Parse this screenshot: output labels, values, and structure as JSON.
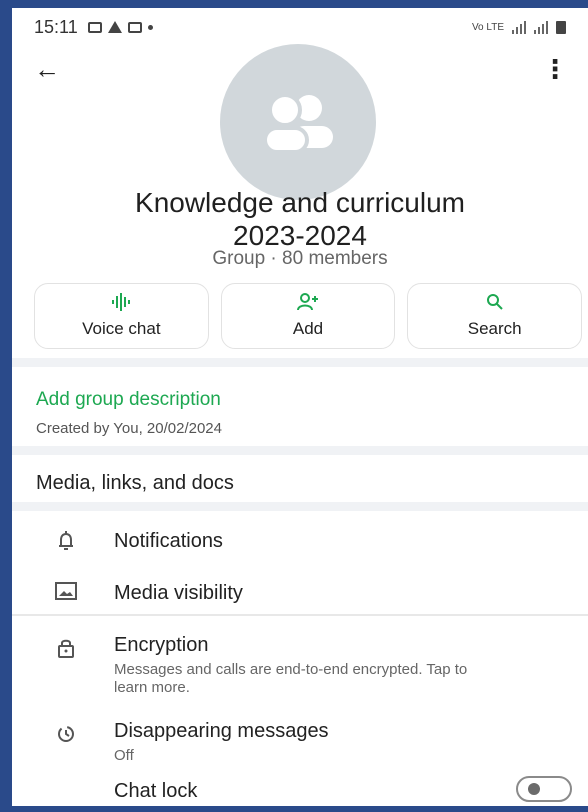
{
  "status": {
    "time": "15:11"
  },
  "group": {
    "title_line1": "Knowledge and curriculum",
    "title_line2": "2023-2024",
    "subtitle": "Group · 80 members"
  },
  "actions": [
    {
      "label": "Voice chat",
      "icon": "voice-wave-icon"
    },
    {
      "label": "Add",
      "icon": "add-person-icon"
    },
    {
      "label": "Search",
      "icon": "search-icon"
    }
  ],
  "description": {
    "link": "Add group description",
    "created": "Created by You, 20/02/2024"
  },
  "media": {
    "label": "Media, links, and docs"
  },
  "settings": [
    {
      "label": "Notifications",
      "icon": "bell-icon"
    },
    {
      "label": "Media visibility",
      "icon": "image-icon"
    },
    {
      "label": "Encryption",
      "icon": "lock-icon",
      "sub": "Messages and calls are end-to-end encrypted. Tap to learn more."
    },
    {
      "label": "Disappearing messages",
      "icon": "timer-icon",
      "sub": "Off"
    },
    {
      "label": "Chat lock",
      "icon": "chat-lock-icon",
      "toggle": false
    }
  ],
  "colors": {
    "accent": "#1da851"
  }
}
